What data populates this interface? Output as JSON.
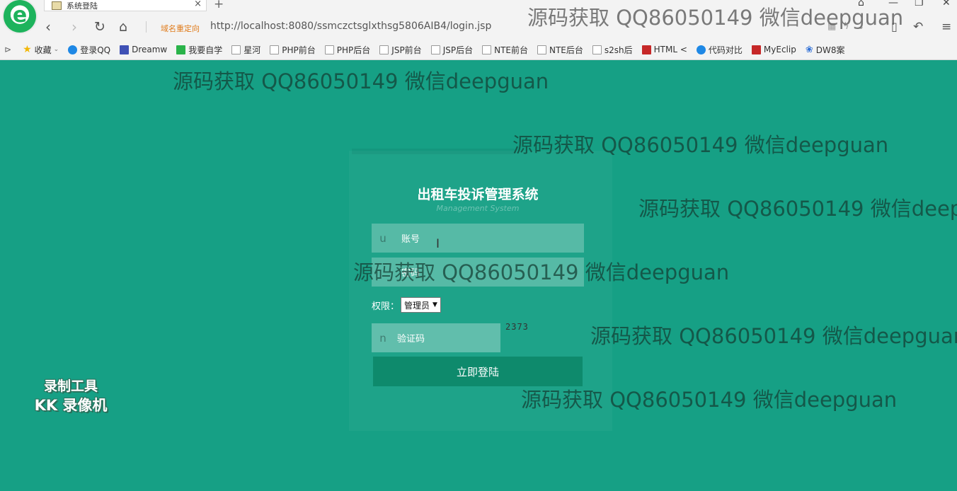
{
  "browser": {
    "tab_title": "系统登陆",
    "redirect_label": "域名重定向",
    "address": "http://localhost:8080/ssmczctsglxthsg5806AIB4/login.jsp",
    "bookmarks": [
      {
        "label": "收藏",
        "icon": "star-icon"
      },
      {
        "label": "登录QQ",
        "icon": "chrome-icon"
      },
      {
        "label": "Dreamw",
        "icon": "dreamweaver-icon"
      },
      {
        "label": "我要自学",
        "icon": "book-icon"
      },
      {
        "label": "星河",
        "icon": "page-icon"
      },
      {
        "label": "PHP前台",
        "icon": "page-icon"
      },
      {
        "label": "PHP后台",
        "icon": "page-icon"
      },
      {
        "label": "JSP前台",
        "icon": "page-icon"
      },
      {
        "label": "JSP后台",
        "icon": "page-icon"
      },
      {
        "label": "NTE前台",
        "icon": "page-icon"
      },
      {
        "label": "NTE后台",
        "icon": "page-icon"
      },
      {
        "label": "s2sh后",
        "icon": "image-icon"
      },
      {
        "label": "HTML <",
        "icon": "html-icon"
      },
      {
        "label": "代码对比",
        "icon": "compare-icon"
      },
      {
        "label": "MyEclip",
        "icon": "myeclipse-icon"
      },
      {
        "label": "DW8案",
        "icon": "paw-icon"
      }
    ]
  },
  "login": {
    "title": "出租车投诉管理系统",
    "subtitle": "Management System",
    "username_label": "账号",
    "username_icon_glyph": "u",
    "password_label": "密码",
    "role_label": "权限：",
    "role_selected": "管理员",
    "captcha_label": "验证码",
    "captcha_icon_glyph": "n",
    "captcha_code": "2373",
    "submit_label": "立即登陆"
  },
  "overlay": {
    "recorder_line1": "录制工具",
    "recorder_line2": "KK 录像机",
    "watermark": "源码获取 QQ86050149 微信deepguan"
  }
}
